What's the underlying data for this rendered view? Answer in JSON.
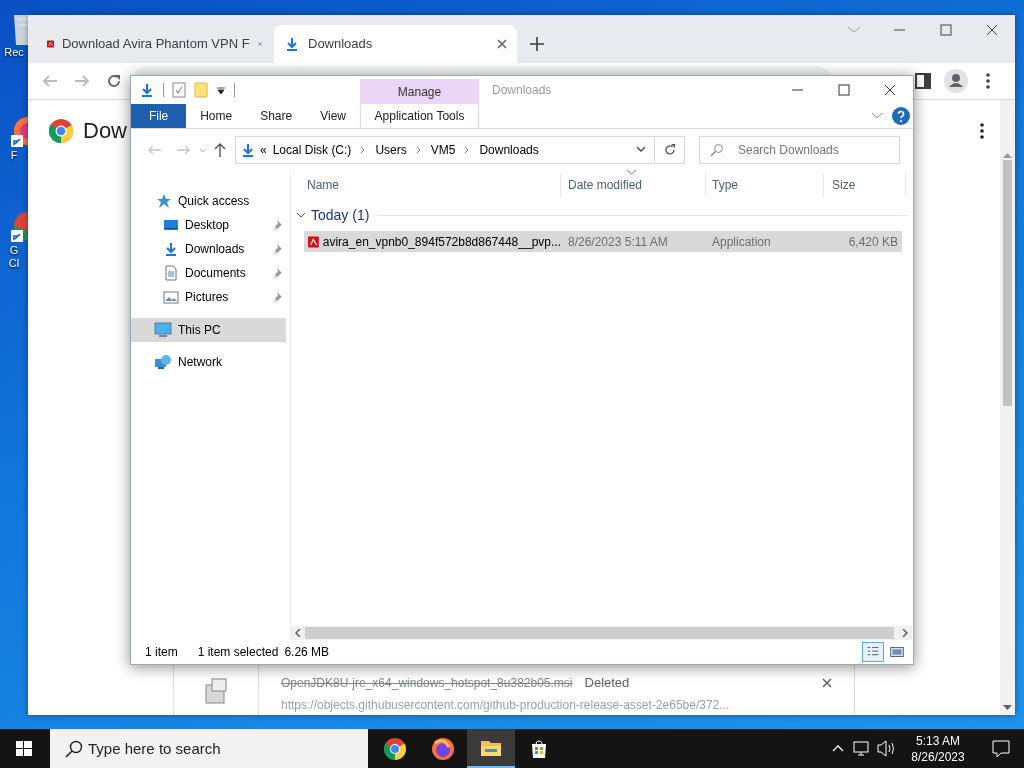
{
  "desktop_icons": [
    {
      "kind": "recycle_bin",
      "shortcut": false,
      "label_lines": [
        "Rec"
      ]
    },
    {
      "kind": "firefox",
      "shortcut": true,
      "label_lines": [
        "F"
      ]
    },
    {
      "kind": "chrome",
      "shortcut": true,
      "label_lines": [
        "G",
        "Cl"
      ]
    }
  ],
  "browser": {
    "tabs": [
      {
        "title": "Download Avira Phantom VPN F",
        "selected": false
      },
      {
        "title": "Downloads",
        "selected": true
      }
    ],
    "page_title": "Dow",
    "download": {
      "file_name": "OpenJDK8U-jre_x64_windows_hotspot_8u382b05.msi",
      "deleted": true,
      "status": "Deleted",
      "url": "https://objects.githubusercontent.com/github-production-release-asset-2e65be/372..."
    }
  },
  "explorer": {
    "contextual_tab": "Manage",
    "title": "Downloads",
    "ribbon_tabs": [
      {
        "kind": "file",
        "label": "File"
      },
      {
        "kind": "tab",
        "label": "Home"
      },
      {
        "kind": "tab",
        "label": "Share"
      },
      {
        "kind": "tab",
        "label": "View"
      },
      {
        "kind": "contextual",
        "label": "Application Tools"
      }
    ],
    "breadcrumb_overflow": "«",
    "breadcrumb": [
      "Local Disk (C:)",
      "Users",
      "VM5",
      "Downloads"
    ],
    "search": {
      "placeholder": "Search Downloads"
    },
    "nav": [
      {
        "label": "Quick access",
        "selected": false,
        "children": [
          {
            "label": "Desktop",
            "pinned": true,
            "selected": false
          },
          {
            "label": "Downloads",
            "pinned": true,
            "selected": false
          },
          {
            "label": "Documents",
            "pinned": true,
            "selected": false
          },
          {
            "label": "Pictures",
            "pinned": true,
            "selected": false
          }
        ]
      },
      {
        "label": "This PC",
        "selected": true
      },
      {
        "label": "Network",
        "selected": false
      }
    ],
    "columns": [
      {
        "label": "Name",
        "sorted": false
      },
      {
        "label": "Date modified",
        "sorted": true
      },
      {
        "label": "Type",
        "sorted": false
      },
      {
        "label": "Size",
        "sorted": false
      }
    ],
    "groups": [
      {
        "label": "Today (1)",
        "expanded": true,
        "rows": [
          {
            "name": "avira_en_vpnb0_894f572b8d867448__pvp...",
            "date_modified": "8/26/2023 5:11 AM",
            "type": "Application",
            "size": "6,420 KB",
            "selected": true
          }
        ]
      }
    ],
    "status_bar": {
      "item_count": "1 item",
      "selection": "1 item selected",
      "selection_size": "6.26 MB"
    },
    "views": [
      {
        "kind": "details",
        "selected": true
      },
      {
        "kind": "large_icons",
        "selected": false
      }
    ]
  },
  "taskbar": {
    "search": {
      "placeholder": "Type here to search"
    },
    "apps": [
      {
        "kind": "chrome",
        "active": false
      },
      {
        "kind": "firefox",
        "active": false
      },
      {
        "kind": "explorer",
        "active": true
      },
      {
        "kind": "store",
        "active": false
      }
    ],
    "time": "5:13 AM",
    "date": "8/26/2023"
  }
}
